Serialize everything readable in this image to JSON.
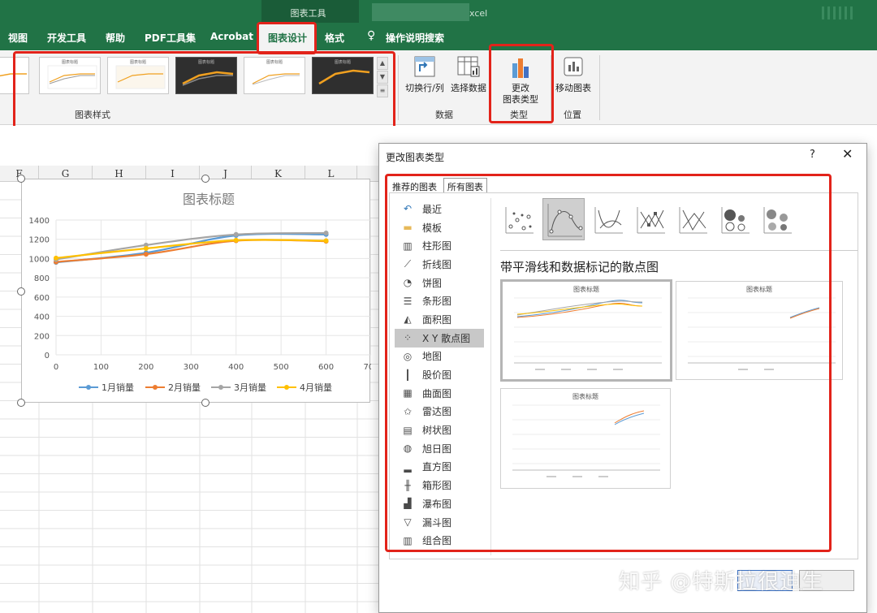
{
  "ribbon": {
    "context_group": "图表工具",
    "app_title": "xcel",
    "tabs": [
      "视图",
      "开发工具",
      "帮助",
      "PDF工具集",
      "Acrobat",
      "图表设计",
      "格式",
      "操作说明搜索"
    ],
    "active_tab": "图表设计",
    "groups": {
      "chart_styles": "图表样式",
      "data": "数据",
      "type": "类型",
      "location": "位置"
    },
    "buttons": {
      "switch_row_col": "切换行/列",
      "select_data": "选择数据",
      "change_chart_type": "更改\n图表类型",
      "move_chart": "移动图表"
    },
    "thumb_titles": [
      "图表标题",
      "图表标题",
      "图表标题",
      "图表标题",
      "图表标题"
    ]
  },
  "sheet": {
    "columns": [
      "F",
      "G",
      "H",
      "I",
      "J",
      "K",
      "L"
    ]
  },
  "chart_data": {
    "type": "scatter",
    "title": "图表标题",
    "x": [
      0,
      200,
      400,
      600
    ],
    "xlim": [
      0,
      700
    ],
    "xticks": [
      "0",
      "100",
      "200",
      "300",
      "400",
      "500",
      "600",
      "700"
    ],
    "ylim": [
      0,
      1400
    ],
    "yticks": [
      "0",
      "200",
      "400",
      "600",
      "800",
      "1000",
      "1200",
      "1400"
    ],
    "grid": true,
    "legend": "bottom",
    "series": [
      {
        "name": "1月销量",
        "color": "#5b9bd5",
        "values": [
          960,
          1060,
          1240,
          1250
        ]
      },
      {
        "name": "2月销量",
        "color": "#ed7d31",
        "values": [
          965,
          1045,
          1185,
          1180
        ]
      },
      {
        "name": "3月销量",
        "color": "#a5a5a5",
        "values": [
          990,
          1140,
          1250,
          1265
        ]
      },
      {
        "name": "4月销量",
        "color": "#ffc000",
        "values": [
          1005,
          1105,
          1190,
          1185
        ]
      }
    ]
  },
  "dialog": {
    "title": "更改图表类型",
    "help": "?",
    "close": "✕",
    "tabs": [
      "推荐的图表",
      "所有图表"
    ],
    "active_tab": "所有图表",
    "chart_types": [
      {
        "label": "最近",
        "icon": "recent-icon"
      },
      {
        "label": "模板",
        "icon": "folder-icon"
      },
      {
        "label": "柱形图",
        "icon": "column-chart-icon"
      },
      {
        "label": "折线图",
        "icon": "line-chart-icon"
      },
      {
        "label": "饼图",
        "icon": "pie-chart-icon"
      },
      {
        "label": "条形图",
        "icon": "bar-chart-icon"
      },
      {
        "label": "面积图",
        "icon": "area-chart-icon"
      },
      {
        "label": "X Y 散点图",
        "icon": "scatter-chart-icon"
      },
      {
        "label": "地图",
        "icon": "map-chart-icon"
      },
      {
        "label": "股价图",
        "icon": "stock-chart-icon"
      },
      {
        "label": "曲面图",
        "icon": "surface-chart-icon"
      },
      {
        "label": "雷达图",
        "icon": "radar-chart-icon"
      },
      {
        "label": "树状图",
        "icon": "treemap-chart-icon"
      },
      {
        "label": "旭日图",
        "icon": "sunburst-chart-icon"
      },
      {
        "label": "直方图",
        "icon": "histogram-chart-icon"
      },
      {
        "label": "箱形图",
        "icon": "box-whisker-chart-icon"
      },
      {
        "label": "瀑布图",
        "icon": "waterfall-chart-icon"
      },
      {
        "label": "漏斗图",
        "icon": "funnel-chart-icon"
      },
      {
        "label": "组合图",
        "icon": "combo-chart-icon"
      }
    ],
    "selected_type": "X Y 散点图",
    "subtype_title": "带平滑线和数据标记的散点图",
    "preview_title": "图表标题"
  },
  "watermark": "知乎 @特斯拉很迪生",
  "colors": {
    "excel_green": "#217346",
    "highlight_red": "#e2231a"
  }
}
